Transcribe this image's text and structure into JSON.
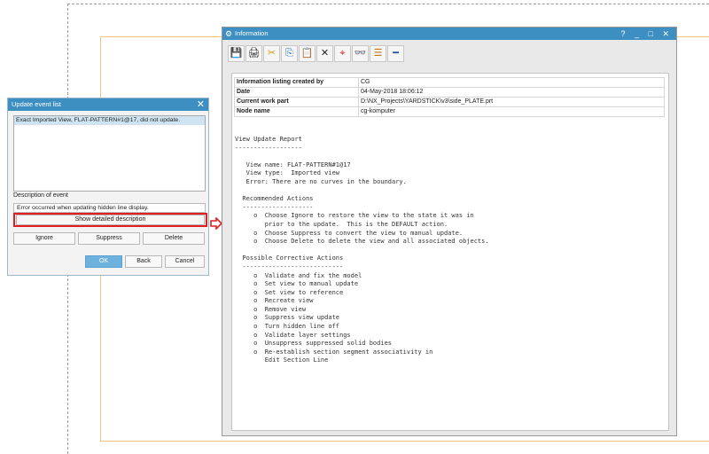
{
  "update_event_list": {
    "title": "Update event list",
    "close_glyph": "✕",
    "events": [
      "Exact Imported View, FLAT-PATTERN#1@17, did not update."
    ],
    "description_label": "Description of event",
    "description_value": "Error occurred when updating hidden line display.",
    "show_detailed_label": "Show detailed description",
    "ignore_label": "Ignore",
    "suppress_label": "Suppress",
    "delete_label": "Delete",
    "ok_label": "OK",
    "back_label": "Back",
    "cancel_label": "Cancel"
  },
  "information_window": {
    "title": "Information",
    "window_controls": "? _ □ ✕",
    "toolbar_icons": [
      "save-icon",
      "print-icon",
      "cut-icon",
      "copy-icon",
      "paste-icon",
      "delete-icon",
      "find-icon",
      "binoculars-icon",
      "format-icon",
      "minimize-icon"
    ],
    "toolbar_glyphs": [
      "💾",
      "🖨",
      "✂",
      "⎘",
      "📋",
      "✕",
      "⌖",
      "👓",
      "☰",
      "━"
    ],
    "header": [
      {
        "key": "Information listing created by",
        "value": "CG"
      },
      {
        "key": "Date",
        "value": "04-May-2018 18:06:12"
      },
      {
        "key": "Current work part",
        "value": "D:\\NX_Projects\\YARDSTICK\\v3\\side_PLATE.prt"
      },
      {
        "key": "Node name",
        "value": "cg-komputer"
      }
    ],
    "report": "View Update Report\n------------------\n\n   View name: FLAT-PATTERN#1@17\n   View type:  Imported view\n   Error: There are no curves in the boundary.\n\n  Recommended Actions\n  -------------------\n     o  Choose Ignore to restore the view to the state it was in\n        prior to the update.  This is the DEFAULT action.\n     o  Choose Suppress to convert the view to manual update.\n     o  Choose Delete to delete the view and all associated objects.\n\n  Possible Corrective Actions\n  ---------------------------\n     o  Validate and fix the model\n     o  Set view to manual update\n     o  Set view to reference\n     o  Recreate view\n     o  Remove view\n     o  Suppress view update\n     o  Turn hidden line off\n     o  Validate layer settings\n     o  Unsuppress suppressed solid bodies\n     o  Re-establish section segment associativity in\n        Edit Section Line"
  },
  "colors": {
    "title_bar": "#3c8fc0",
    "highlight_box": "#e21e1e",
    "ok_button": "#6db1dd",
    "selection": "#cfe4f2"
  }
}
